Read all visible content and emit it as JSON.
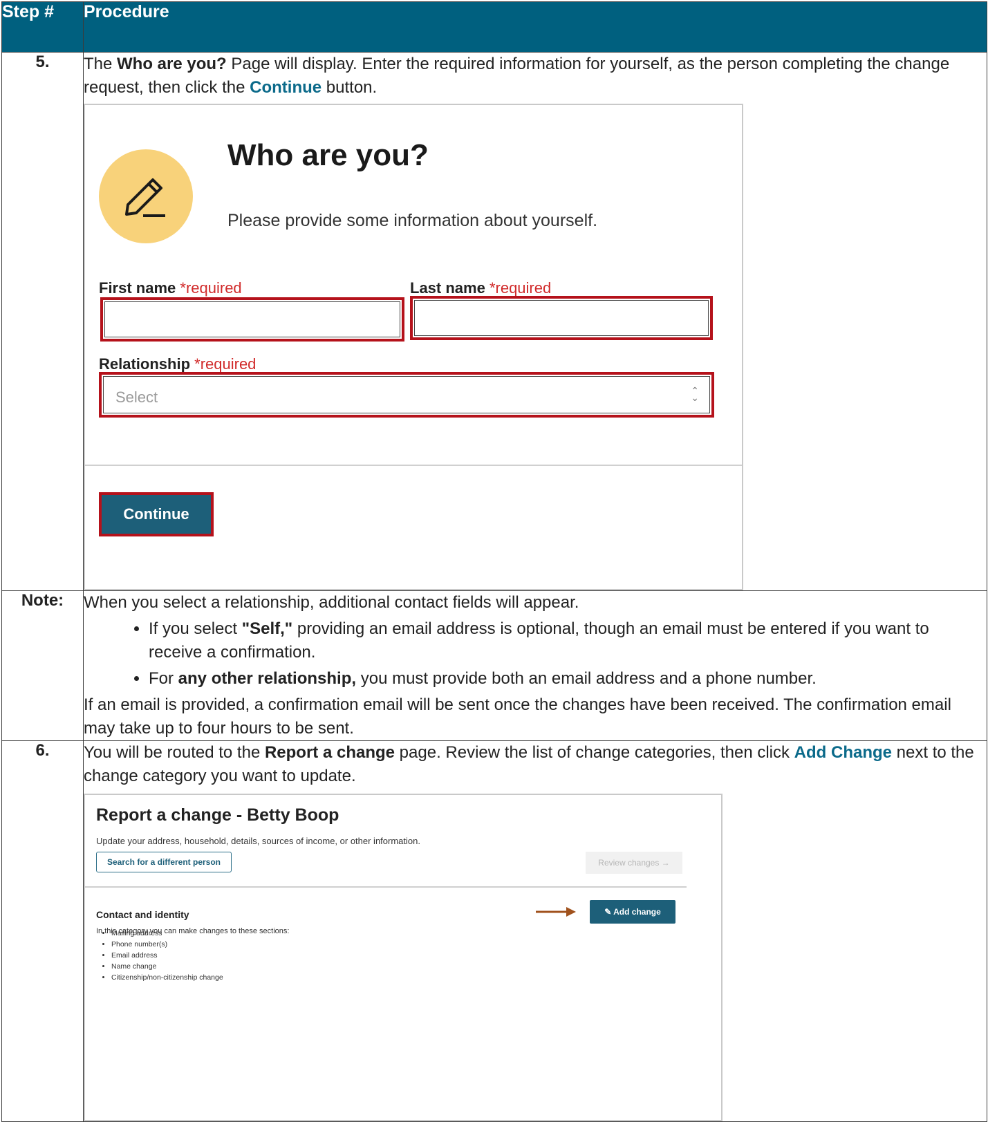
{
  "header": {
    "step_col": "Step #",
    "proc_col": "Procedure"
  },
  "row5": {
    "step": "5.",
    "t1": "The ",
    "b1": "Who are you?",
    "t2": " Page will display. Enter the required information for yourself, as the person completing the change request, then click the ",
    "b2": "Continue",
    "t3": " button.",
    "screenshot": {
      "title": "Who are you?",
      "subtitle": "Please provide some information about yourself.",
      "first_name_label": "First name",
      "last_name_label": "Last name",
      "relationship_label": "Relationship",
      "required": "*required",
      "first_name_value": "",
      "last_name_value": "",
      "relationship_placeholder": "Select",
      "continue_label": "Continue",
      "icon": "pencil-icon",
      "icon_bg_color": "#f8d27a",
      "error_border_color": "#b5121b"
    }
  },
  "note": {
    "label": "Note:",
    "intro": "When you select a relationship, additional contact fields will appear.",
    "b1_a": "If you select ",
    "b1_b": "\"Self,\"",
    "b1_c": " providing an email address is optional, though an email must be entered if you want to receive a confirmation.",
    "b2_a": "For ",
    "b2_b": "any other relationship,",
    "b2_c": " you must provide both an email address and a phone number.",
    "footer": "If an email is provided, a confirmation email will be sent once the changes have been received. The confirmation email may take up to four hours to be sent."
  },
  "row6": {
    "step": "6.",
    "t1": "You will be routed to the ",
    "b1": "Report a change",
    "t2": " page. Review the list of change categories, then click ",
    "b2": "Add Change",
    "t3": " next to the change category you want to update.",
    "screenshot": {
      "title": "Report a change - Betty Boop",
      "subtitle": "Update your address, household, details, sources of income, or other information.",
      "search_button": "Search for a different person",
      "review_button": "Review changes →",
      "section_title": "Contact and identity",
      "section_desc": "In this category you can make changes to these sections:",
      "items": [
        "Mailing address",
        "Phone number(s)",
        "Email address",
        "Name change",
        "Citizenship/non-citizenship change"
      ],
      "add_button": "Add change",
      "arrow_color": "#a0521d"
    }
  }
}
